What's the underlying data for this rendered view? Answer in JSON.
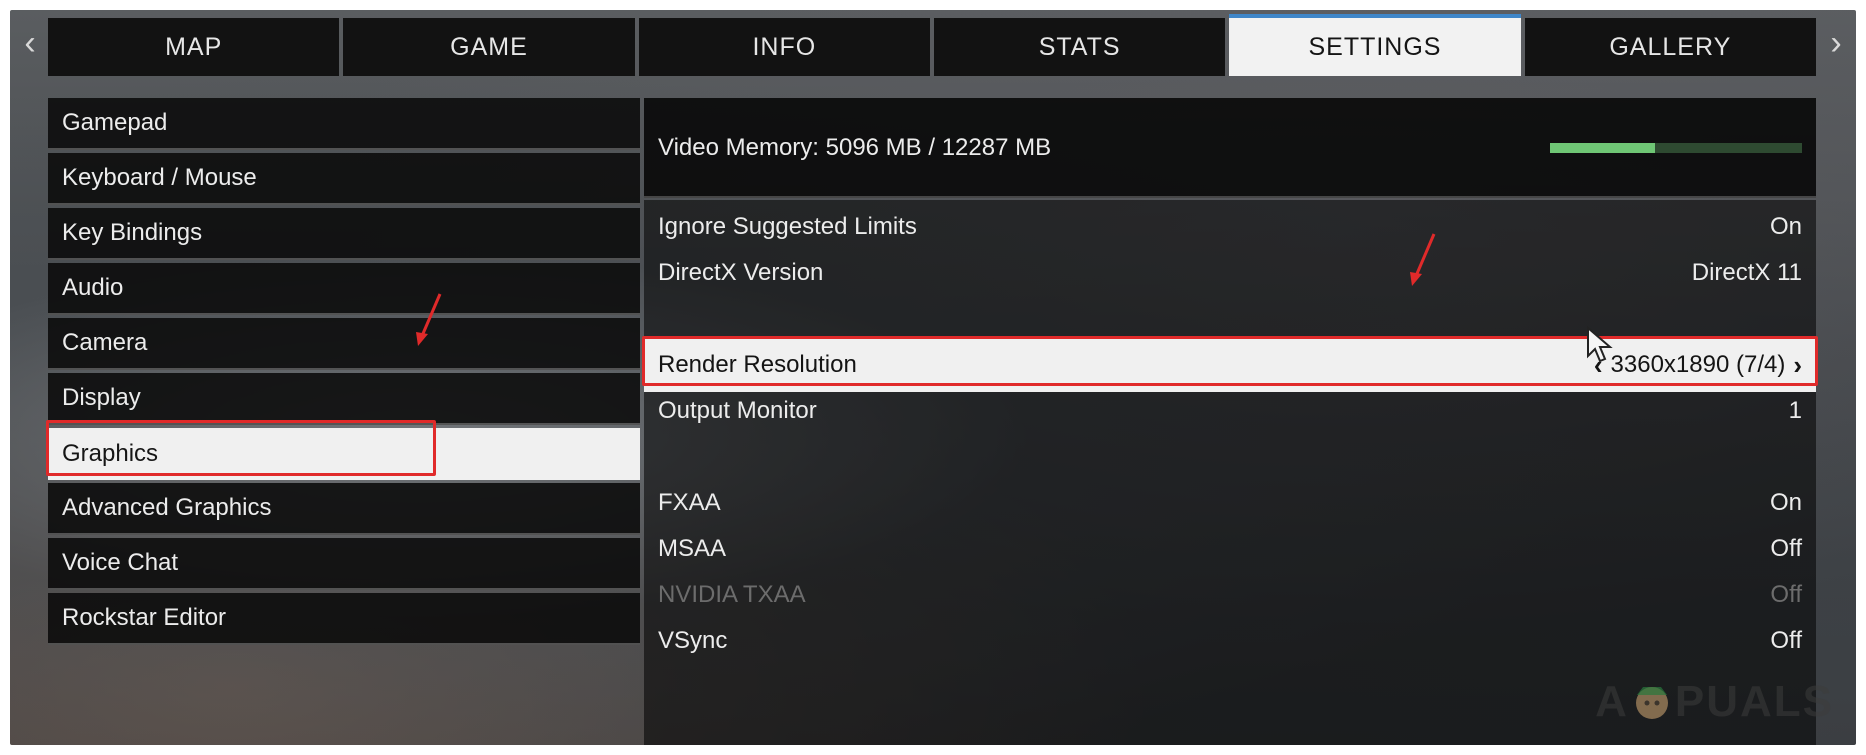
{
  "tabs": [
    {
      "label": "MAP",
      "active": false
    },
    {
      "label": "GAME",
      "active": false
    },
    {
      "label": "INFO",
      "active": false
    },
    {
      "label": "STATS",
      "active": false
    },
    {
      "label": "SETTINGS",
      "active": true
    },
    {
      "label": "GALLERY",
      "active": false
    }
  ],
  "nav": {
    "prev_icon": "chevron-left-icon",
    "next_icon": "chevron-right-icon",
    "prev_glyph": "‹",
    "next_glyph": "›"
  },
  "sidebar": {
    "items": [
      {
        "label": "Gamepad"
      },
      {
        "label": "Keyboard / Mouse"
      },
      {
        "label": "Key Bindings"
      },
      {
        "label": "Audio"
      },
      {
        "label": "Camera"
      },
      {
        "label": "Display"
      },
      {
        "label": "Graphics",
        "active": true
      },
      {
        "label": "Advanced Graphics"
      },
      {
        "label": "Voice Chat"
      },
      {
        "label": "Rockstar Editor"
      }
    ]
  },
  "memory": {
    "label": "Video Memory: 5096 MB / 12287 MB",
    "used_fraction": 0.4147,
    "bar_color": "#6fc675"
  },
  "settings": [
    {
      "label": "Ignore Suggested Limits",
      "value": "On"
    },
    {
      "label": "DirectX Version",
      "value": "DirectX 11"
    },
    {
      "label": "Render Resolution",
      "value": "3360x1890 (7/4)",
      "active": true
    },
    {
      "label": "Output Monitor",
      "value": "1"
    },
    {
      "label": "FXAA",
      "value": "On"
    },
    {
      "label": "MSAA",
      "value": "Off"
    },
    {
      "label": "NVIDIA TXAA",
      "value": "Off",
      "disabled": true
    },
    {
      "label": "VSync",
      "value": "Off"
    }
  ],
  "highlight_color": "#e02a2a",
  "watermark": {
    "text_left": "A",
    "text_right": "PUALS"
  }
}
